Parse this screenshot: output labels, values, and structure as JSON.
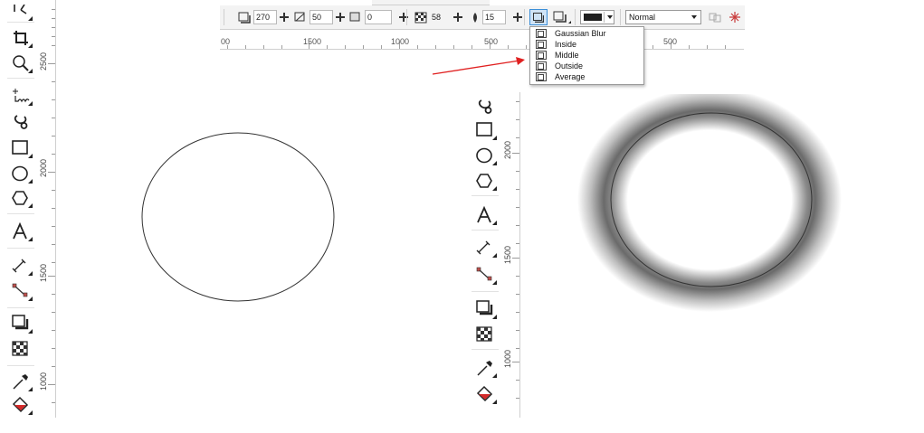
{
  "property_bar": {
    "direction_value": "270",
    "distance_value": "50",
    "fade_value": "0",
    "opacity_value": "58",
    "feather_value": "15",
    "blend_mode": "Normal",
    "fill_color": "#1e1e1e"
  },
  "horizontal_ruler": {
    "labels": [
      "00",
      "1500",
      "1000",
      "500",
      "500"
    ]
  },
  "left_ruler": {
    "labels": [
      "2500",
      "2000",
      "1500",
      "1000"
    ]
  },
  "right_ruler": {
    "labels": [
      "2000",
      "1500",
      "1000"
    ]
  },
  "feather_menu": {
    "items": [
      {
        "label": "Gaussian Blur",
        "icon": "gaussian-blur-icon"
      },
      {
        "label": "Inside",
        "icon": "inside-feather-icon"
      },
      {
        "label": "Middle",
        "icon": "middle-feather-icon"
      },
      {
        "label": "Outside",
        "icon": "outside-feather-icon"
      },
      {
        "label": "Average",
        "icon": "average-feather-icon"
      }
    ]
  },
  "annotation": {
    "arrow_color": "#e02020"
  },
  "shapes": {
    "plain_ellipse_stroke": "#333333",
    "shadow_color": "#6a6a6a"
  },
  "tools": [
    "pick-tool-icon",
    "crop-tool-icon",
    "zoom-tool-icon",
    "freehand-tool-icon",
    "artistic-media-tool-icon",
    "rectangle-tool-icon",
    "ellipse-tool-icon",
    "polygon-tool-icon",
    "text-tool-icon",
    "parallel-dimension-tool-icon",
    "connector-tool-icon",
    "drop-shadow-tool-icon",
    "transparency-tool-icon",
    "eyedropper-tool-icon",
    "interactive-fill-tool-icon"
  ]
}
